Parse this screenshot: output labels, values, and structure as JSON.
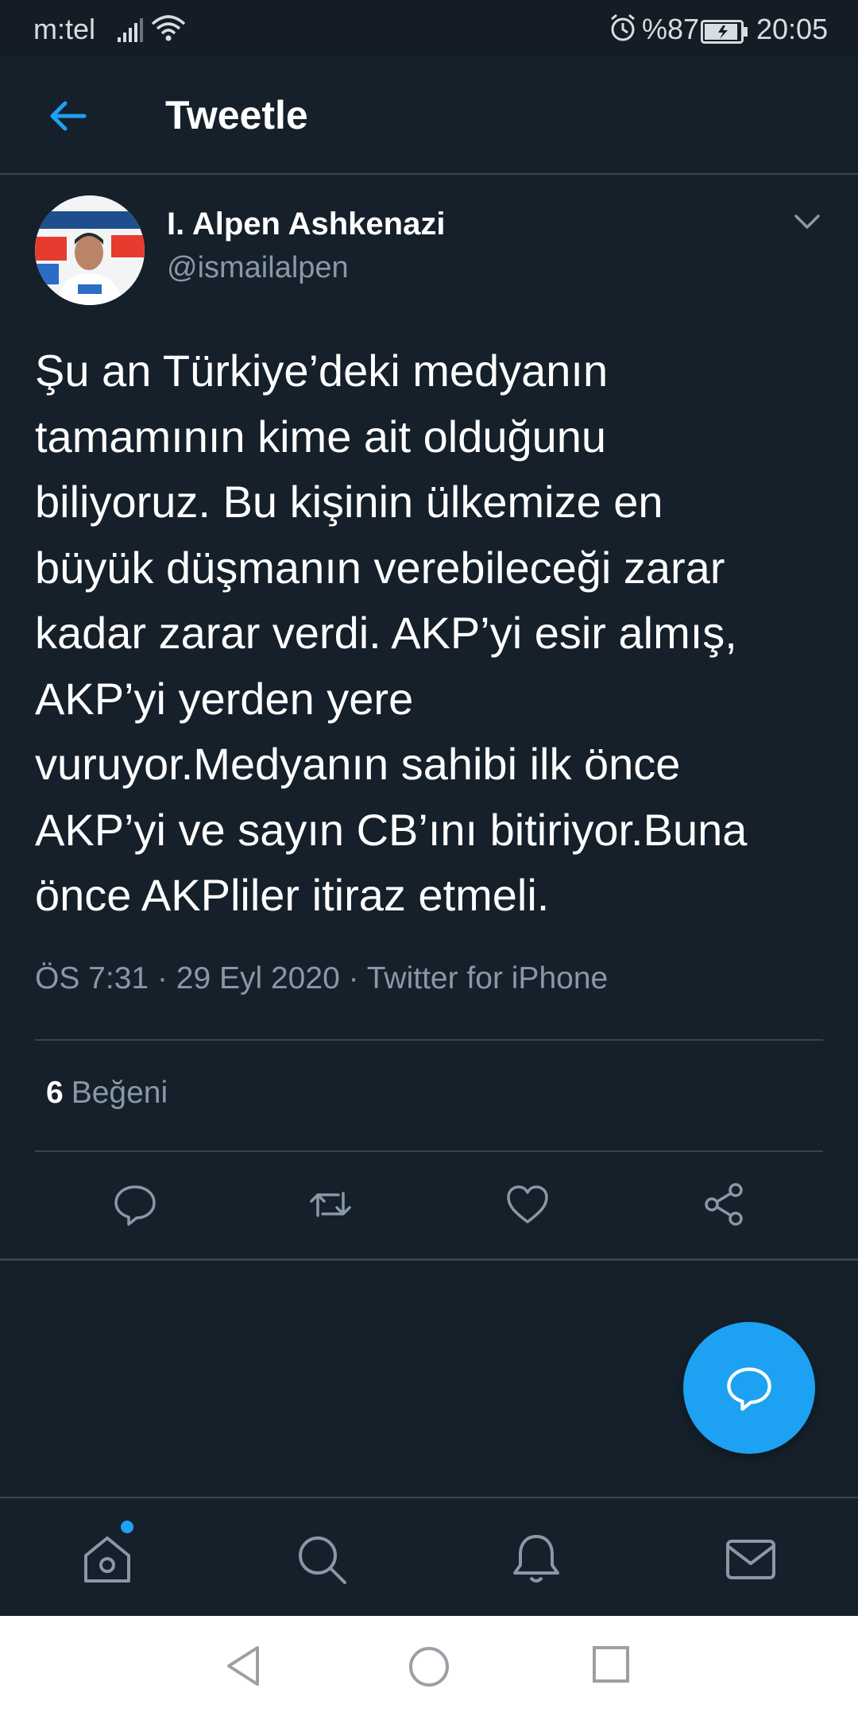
{
  "status_bar": {
    "carrier": "m:tel",
    "battery": "%87",
    "time": "20:05"
  },
  "header": {
    "title": "Tweetle"
  },
  "tweet": {
    "author_name": "I. Alpen Ashkenazi",
    "author_handle": "@ismailalpen",
    "text": "Şu an Türkiye’deki medyanın\ntamamının kime ait olduğunu\nbiliyoruz. Bu kişinin ülkemize en\nbüyük düşmanın verebileceği zarar\nkadar zarar verdi. AKP’yi esir almış,\nAKP’yi yerden yere\nvuruyor.Medyanın sahibi ilk önce\nAKP’yi ve sayın CB’ını bitiriyor.Buna\nönce AKPliler itiraz etmeli.",
    "time": "ÖS 7:31",
    "date": "29 Eyl 2020",
    "source": "Twitter for iPhone",
    "like_count": "6",
    "like_label": "Beğeni"
  },
  "actions": [
    "reply-icon",
    "retweet-icon",
    "like-icon",
    "share-icon"
  ],
  "bottom_nav": [
    "home-icon",
    "search-icon",
    "notifications-icon",
    "messages-icon"
  ],
  "colors": {
    "background": "#15202b",
    "accent": "#1da1f2",
    "secondary_text": "#8899a6",
    "divider": "#38444d"
  }
}
